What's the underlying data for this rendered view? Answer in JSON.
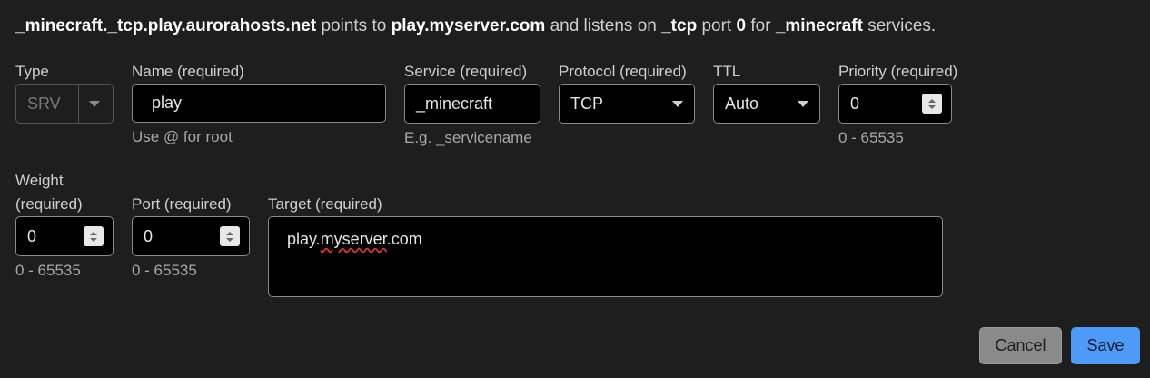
{
  "summary": {
    "record": "_minecraft._tcp.play.aurorahosts.net",
    "t1": " points to ",
    "target": "play.myserver.com",
    "t2": " and listens on ",
    "protocol": "_tcp",
    "t3": " port ",
    "port": "0",
    "t4": " for ",
    "service": "_minecraft",
    "t5": " services."
  },
  "fields": {
    "type": {
      "label": "Type",
      "value": "SRV"
    },
    "name": {
      "label": "Name (required)",
      "value": "play",
      "hint": "Use @ for root"
    },
    "service": {
      "label": "Service (required)",
      "value": "_minecraft",
      "hint": "E.g. _servicename"
    },
    "protocol": {
      "label": "Protocol (required)",
      "value": "TCP"
    },
    "ttl": {
      "label": "TTL",
      "value": "Auto"
    },
    "priority": {
      "label": "Priority (required)",
      "value": "0",
      "hint": "0 - 65535"
    },
    "weight": {
      "label_line1": "Weight",
      "label_line2": "(required)",
      "value": "0",
      "hint": "0 - 65535"
    },
    "port": {
      "label": "Port (required)",
      "value": "0",
      "hint": "0 - 65535"
    },
    "target": {
      "label": "Target (required)",
      "value_part1": "play.",
      "value_squiggle": "myserver",
      "value_part2": ".com"
    }
  },
  "buttons": {
    "cancel": "Cancel",
    "save": "Save"
  }
}
